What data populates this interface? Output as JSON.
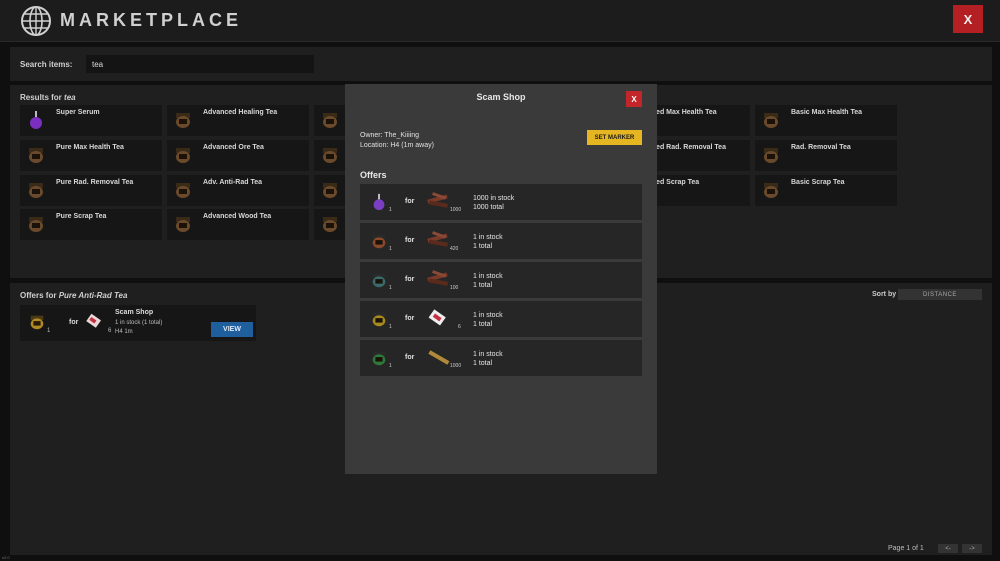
{
  "header": {
    "title": "MARKETPLACE",
    "close_label": "X"
  },
  "search": {
    "label": "Search items:",
    "value": "tea"
  },
  "results": {
    "label_prefix": "Results for",
    "label_query": "tea",
    "items": [
      {
        "name": "Super Serum",
        "icon": "purple-serum-icon"
      },
      {
        "name": "Advanced Healing Tea",
        "icon": "tea-pot-icon"
      },
      {
        "name": "",
        "icon": "tea-pot-icon"
      },
      {
        "name": "anced Max Health Tea",
        "icon": "tea-pot-icon"
      },
      {
        "name": "Basic Max Health Tea",
        "icon": "tea-pot-icon"
      },
      {
        "name": "Pure Max Health Tea",
        "icon": "tea-pot-icon"
      },
      {
        "name": "Advanced Ore Tea",
        "icon": "tea-pot-icon"
      },
      {
        "name": "",
        "icon": "tea-pot-icon"
      },
      {
        "name": "anced Rad. Removal Tea",
        "icon": "tea-pot-icon"
      },
      {
        "name": "Rad. Removal Tea",
        "icon": "tea-pot-icon"
      },
      {
        "name": "Pure Rad. Removal Tea",
        "icon": "tea-pot-icon"
      },
      {
        "name": "Adv. Anti-Rad Tea",
        "icon": "tea-pot-icon"
      },
      {
        "name": "",
        "icon": "tea-pot-icon"
      },
      {
        "name": "anced Scrap Tea",
        "icon": "tea-pot-icon"
      },
      {
        "name": "Basic Scrap Tea",
        "icon": "tea-pot-icon"
      },
      {
        "name": "Pure Scrap Tea",
        "icon": "tea-pot-icon"
      },
      {
        "name": "Advanced Wood Tea",
        "icon": "tea-pot-icon"
      },
      {
        "name": "",
        "icon": "tea-pot-icon"
      }
    ]
  },
  "offers_section": {
    "label_prefix": "Offers for",
    "label_item": "Pure Anti-Rad Tea",
    "sort_label": "Sort by",
    "sort_value": "DISTANCE",
    "card": {
      "item_qty": "1",
      "for_label": "for",
      "currency_qty": "6",
      "shop_name": "Scam Shop",
      "stock_line": "1 in stock (1 total)",
      "location_line": "H4 1m",
      "view_label": "VIEW"
    }
  },
  "pagination": {
    "text": "Page 1 of 1",
    "prev": "<-",
    "next": "->"
  },
  "corner_text": "v2.0",
  "modal": {
    "title": "Scam Shop",
    "close_label": "X",
    "owner": "Owner: The_Kiiiing",
    "location": "Location: H4 (1m away)",
    "marker_label": "SET MARKER",
    "offers_heading": "Offers",
    "offers": [
      {
        "item_qty": "1",
        "for": "for",
        "currency_qty": "1000",
        "stock": "1000 in stock",
        "total": "1000 total",
        "item_color": "#7a3fc0",
        "currency": "wood-pile-icon"
      },
      {
        "item_qty": "1",
        "for": "for",
        "currency_qty": "420",
        "stock": "1 in stock",
        "total": "1 total",
        "item_color": "#8a4a2a",
        "currency": "wood-pile-icon"
      },
      {
        "item_qty": "1",
        "for": "for",
        "currency_qty": "100",
        "stock": "1 in stock",
        "total": "1 total",
        "item_color": "#3a6a6a",
        "currency": "wood-pile-icon"
      },
      {
        "item_qty": "1",
        "for": "for",
        "currency_qty": "6",
        "stock": "1 in stock",
        "total": "1 total",
        "item_color": "#a88a20",
        "currency": "ticket-icon"
      },
      {
        "item_qty": "1",
        "for": "for",
        "currency_qty": "1000",
        "stock": "1 in stock",
        "total": "1 total",
        "item_color": "#2f7a3a",
        "currency": "stick-icon"
      }
    ]
  }
}
